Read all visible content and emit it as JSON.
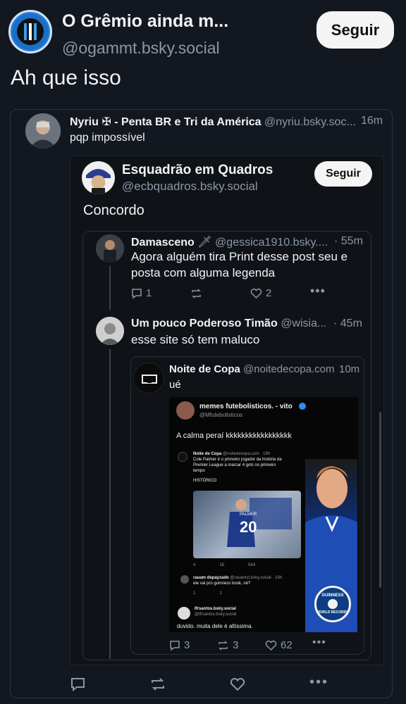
{
  "colors": {
    "background": "#131820",
    "card_border": "#2c3440",
    "muted_text": "#8b97a6",
    "button_bg": "#f4f4f4",
    "inner_bg": "#161b22"
  },
  "top_post": {
    "display_name": "O Grêmio ainda m...",
    "handle": "@ogammt.bsky.social",
    "follow_label": "Seguir",
    "text": "Ah que isso"
  },
  "quote1": {
    "display_name": "Nyriu ✠ - Penta BR e Tri da América",
    "handle": "@nyriu.bsky.soc...",
    "time": "16m",
    "text": "pqp impossível"
  },
  "quote2": {
    "display_name": "Esquadrão em Quadros",
    "handle": "@ecbquadros.bsky.social",
    "follow_label": "Seguir",
    "text": "Concordo"
  },
  "reply1": {
    "display_name": "Damasceno",
    "handle": "@gessica1910.bsky....",
    "time": "· 55m",
    "text_line1": "Agora alguém tira Print desse post seu e",
    "text_line2": "posta com alguma legenda",
    "replies": "1",
    "likes": "2"
  },
  "reply2": {
    "display_name": "Um pouco Poderoso Timão",
    "handle": "@wisia...",
    "time": "· 45m",
    "text": "esse site só tem maluco"
  },
  "quote3": {
    "display_name": "Noite de Copa",
    "handle": "@noitedecopa.com",
    "time": "10m",
    "text": "ué",
    "replies": "3",
    "reposts": "3",
    "likes": "62"
  },
  "embedded_image": {
    "header_name": "memes futebolisticos. - vito",
    "header_handle": "@Mfutebolisticos",
    "caption": "A calma peraí kkkkkkkkkkkkkkkkk",
    "inner_name": "Noite de Copa",
    "inner_handle": "@noitedecopa.com · 19h",
    "inner_text_1": "Cole Palmer é o primeiro jogador da história da",
    "inner_text_2": "Premier League a marcar 4 gols no primeiro",
    "inner_text_3": "tempo",
    "inner_text_4": "HISTÓRICO",
    "jersey_name": "PALMER",
    "jersey_number": "20",
    "mini_counts": [
      "4",
      "18",
      "544"
    ],
    "comment1_name": "rauam depayzado",
    "comment1_handle": "@rauamct.bsky.social · 19h",
    "comment1_text": "ele vai pro guinness book, né?",
    "comment1_counts": [
      "1",
      "1"
    ],
    "comment2_name": "lfrsantos.bsky.social",
    "comment2_handle": "@lfrsantos.bsky.social",
    "comment2_text": "duvido. muita dele é altíssima.",
    "guinness_line1": "GUINNESS",
    "guinness_line2": "WORLD RECORDS"
  }
}
